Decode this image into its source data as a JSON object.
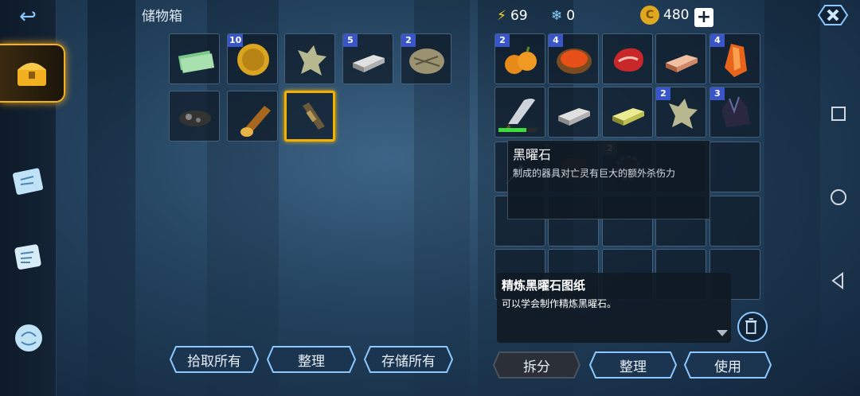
{
  "storage": {
    "title": "储物箱",
    "slots": [
      {
        "icon": "cash-stack-icon",
        "count": ""
      },
      {
        "icon": "gold-coin-icon",
        "count": "10"
      },
      {
        "icon": "hide-icon",
        "count": ""
      },
      {
        "icon": "iron-ingot-icon",
        "count": "5"
      },
      {
        "icon": "fur-icon",
        "count": "2"
      },
      {
        "icon": "coal-icon",
        "count": ""
      },
      {
        "icon": "log-icon",
        "count": ""
      },
      {
        "icon": "scroll-bundle-icon",
        "count": ""
      }
    ],
    "buttons": {
      "pickup_all": "拾取所有",
      "sort": "整理",
      "store_all": "存储所有"
    }
  },
  "resources": {
    "energy": "69",
    "snow": "0",
    "coins": "480",
    "plus": "+"
  },
  "inventory": {
    "slots": [
      {
        "icon": "pumpkin-icon",
        "count": "2"
      },
      {
        "icon": "stew-icon",
        "count": "4"
      },
      {
        "icon": "meat-icon",
        "count": ""
      },
      {
        "icon": "copper-ingot-icon",
        "count": ""
      },
      {
        "icon": "amber-crystal-icon",
        "count": "4"
      },
      {
        "icon": "scythe-icon",
        "count": "",
        "durability": 0.72
      },
      {
        "icon": "iron-ingot-icon",
        "count": ""
      },
      {
        "icon": "gold-ingot-icon",
        "count": ""
      },
      {
        "icon": "hide-icon",
        "count": "2"
      },
      {
        "icon": "obsidian-icon",
        "count": "3"
      },
      {
        "icon": "knife-icon",
        "count": ""
      },
      {
        "icon": "leather-icon",
        "count": ""
      },
      {
        "icon": "gear-icon",
        "count": "2"
      }
    ],
    "buttons": {
      "split": "拆分",
      "sort": "整理",
      "use": "使用"
    }
  },
  "tooltip_item": {
    "name": "黑曜石",
    "desc": "制成的器具对亡灵有巨大的额外杀伤力"
  },
  "tooltip_selected": {
    "name": "精炼黑曜石图纸",
    "desc": "可以学会制作精炼黑曜石。"
  },
  "colors": {
    "accent": "#f2b000",
    "badge": "#3a55c8",
    "frame": "#8cc8ff"
  }
}
